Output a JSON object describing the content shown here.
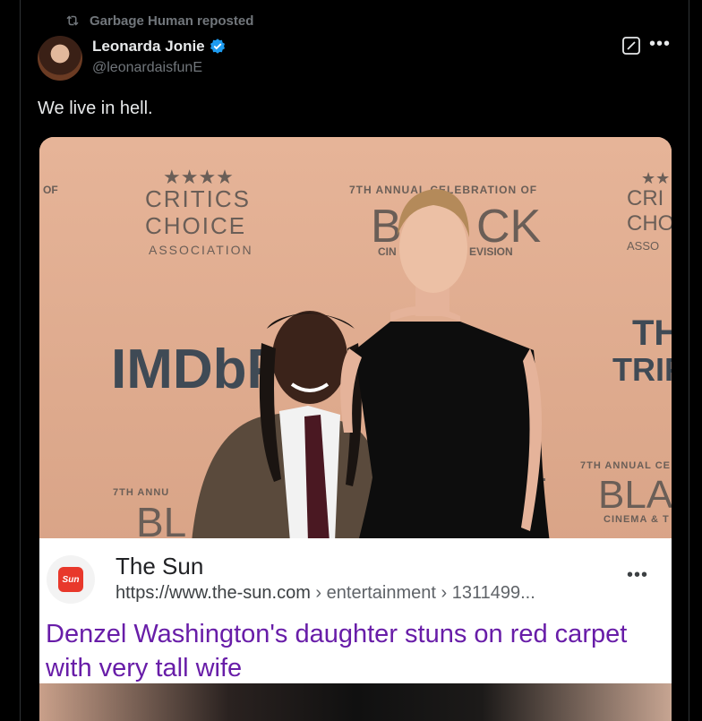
{
  "repost": {
    "label": "Garbage Human reposted",
    "icon": "repost-icon"
  },
  "author": {
    "name": "Leonarda Jonie",
    "handle": "@leonardaisfunE",
    "verified": true
  },
  "tweet": {
    "text": "We live in hell."
  },
  "backdrop": {
    "critics_choice": [
      "CRITICS",
      "CHOICE",
      "ASSOCIATION"
    ],
    "celebration": "7TH ANNUAL CELEBRATION OF",
    "black_partial": "B",
    "black_partial2": "CK",
    "cin_partial": "CIN",
    "evision": "EVISION",
    "imdb": "IMDbP",
    "of": "OF",
    "annual_small": "7TH ANNU",
    "bl": "BL",
    "annual_right": "7TH ANNUAL CE",
    "bla": "BLA",
    "cinema_partial": "CINEMA & T",
    "the": "THE",
    "tripl": "TRIPL",
    "cri": "CRI",
    "cho": "CHO",
    "asso": "ASSO",
    "l_letter": "L"
  },
  "link_card": {
    "source": "The Sun",
    "logo_text": "Sun",
    "url_host": "https://www.the-sun.com",
    "url_path": " › entertainment › 1311499...",
    "title": "Denzel Washington's daughter stuns on red carpet with very tall wife"
  },
  "colors": {
    "card_title": "#681da8",
    "verified": "#1d9bf0",
    "sun_red": "#e8382b",
    "background": "#000000"
  }
}
